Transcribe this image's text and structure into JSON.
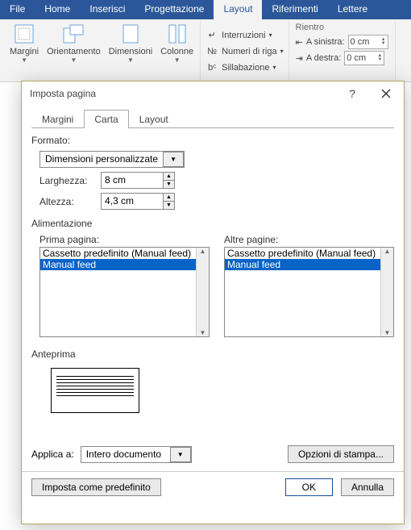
{
  "ribbon": {
    "tabs": {
      "file": "File",
      "home": "Home",
      "inserisci": "Inserisci",
      "progettazione": "Progettazione",
      "layout": "Layout",
      "riferimenti": "Riferimenti",
      "lettere": "Lettere"
    },
    "pageSetup": {
      "margini": "Margini",
      "orientamento": "Orientamento",
      "dimensioni": "Dimensioni",
      "colonne": "Colonne",
      "interruzioni": "Interruzioni",
      "numeriRiga": "Numeri di riga",
      "sillabazione": "Sillabazione"
    },
    "rientro": {
      "title": "Rientro",
      "sinistra_label": "A sinistra:",
      "sinistra_value": "0 cm",
      "destra_label": "A destra:",
      "destra_value": "0 cm"
    }
  },
  "dialog": {
    "title": "Imposta pagina",
    "help": "?",
    "tabs": {
      "margini": "Margini",
      "carta": "Carta",
      "layout": "Layout"
    },
    "formato_label": "Formato:",
    "formato_value": "Dimensioni personalizzate",
    "larghezza_label": "Larghezza:",
    "larghezza_value": "8 cm",
    "altezza_label": "Altezza:",
    "altezza_value": "4,3 cm",
    "alimentazione_label": "Alimentazione",
    "prima_pagina_label": "Prima pagina:",
    "altre_pagine_label": "Altre pagine:",
    "tray_options": {
      "opt0": "Cassetto predefinito (Manual feed)",
      "opt1": "Manual feed"
    },
    "anteprima_label": "Anteprima",
    "applica_label": "Applica a:",
    "applica_value": "Intero documento",
    "opzioni_stampa": "Opzioni di stampa...",
    "imposta_predef": "Imposta come predefinito",
    "ok": "OK",
    "annulla": "Annulla"
  }
}
